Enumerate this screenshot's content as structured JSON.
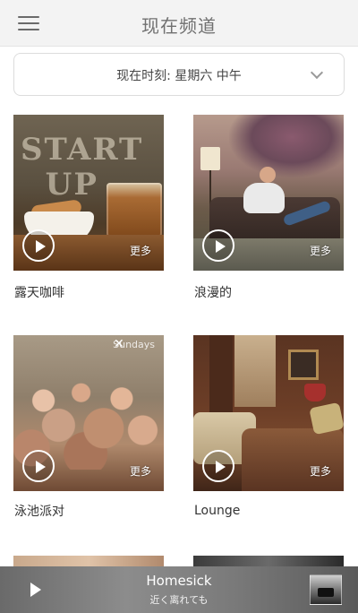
{
  "header": {
    "title": "现在频道",
    "menu_icon": "hamburger-icon"
  },
  "time_selector": {
    "label": "现在时刻: 星期六 中午",
    "icon": "chevron-down-icon"
  },
  "channels": [
    {
      "title": "露天咖啡",
      "more": "更多"
    },
    {
      "title": "浪漫的",
      "more": "更多"
    },
    {
      "title": "泳池派对",
      "more": "更多"
    },
    {
      "title": "Lounge",
      "more": "更多"
    }
  ],
  "mini_player": {
    "track_title": "Homesick",
    "track_artist": "近く离れても",
    "play_icon": "play-icon"
  },
  "colors": {
    "header_bg": "#f3f3f3",
    "text": "#333333",
    "muted_text": "#707070",
    "divider": "#dcdcdc"
  }
}
